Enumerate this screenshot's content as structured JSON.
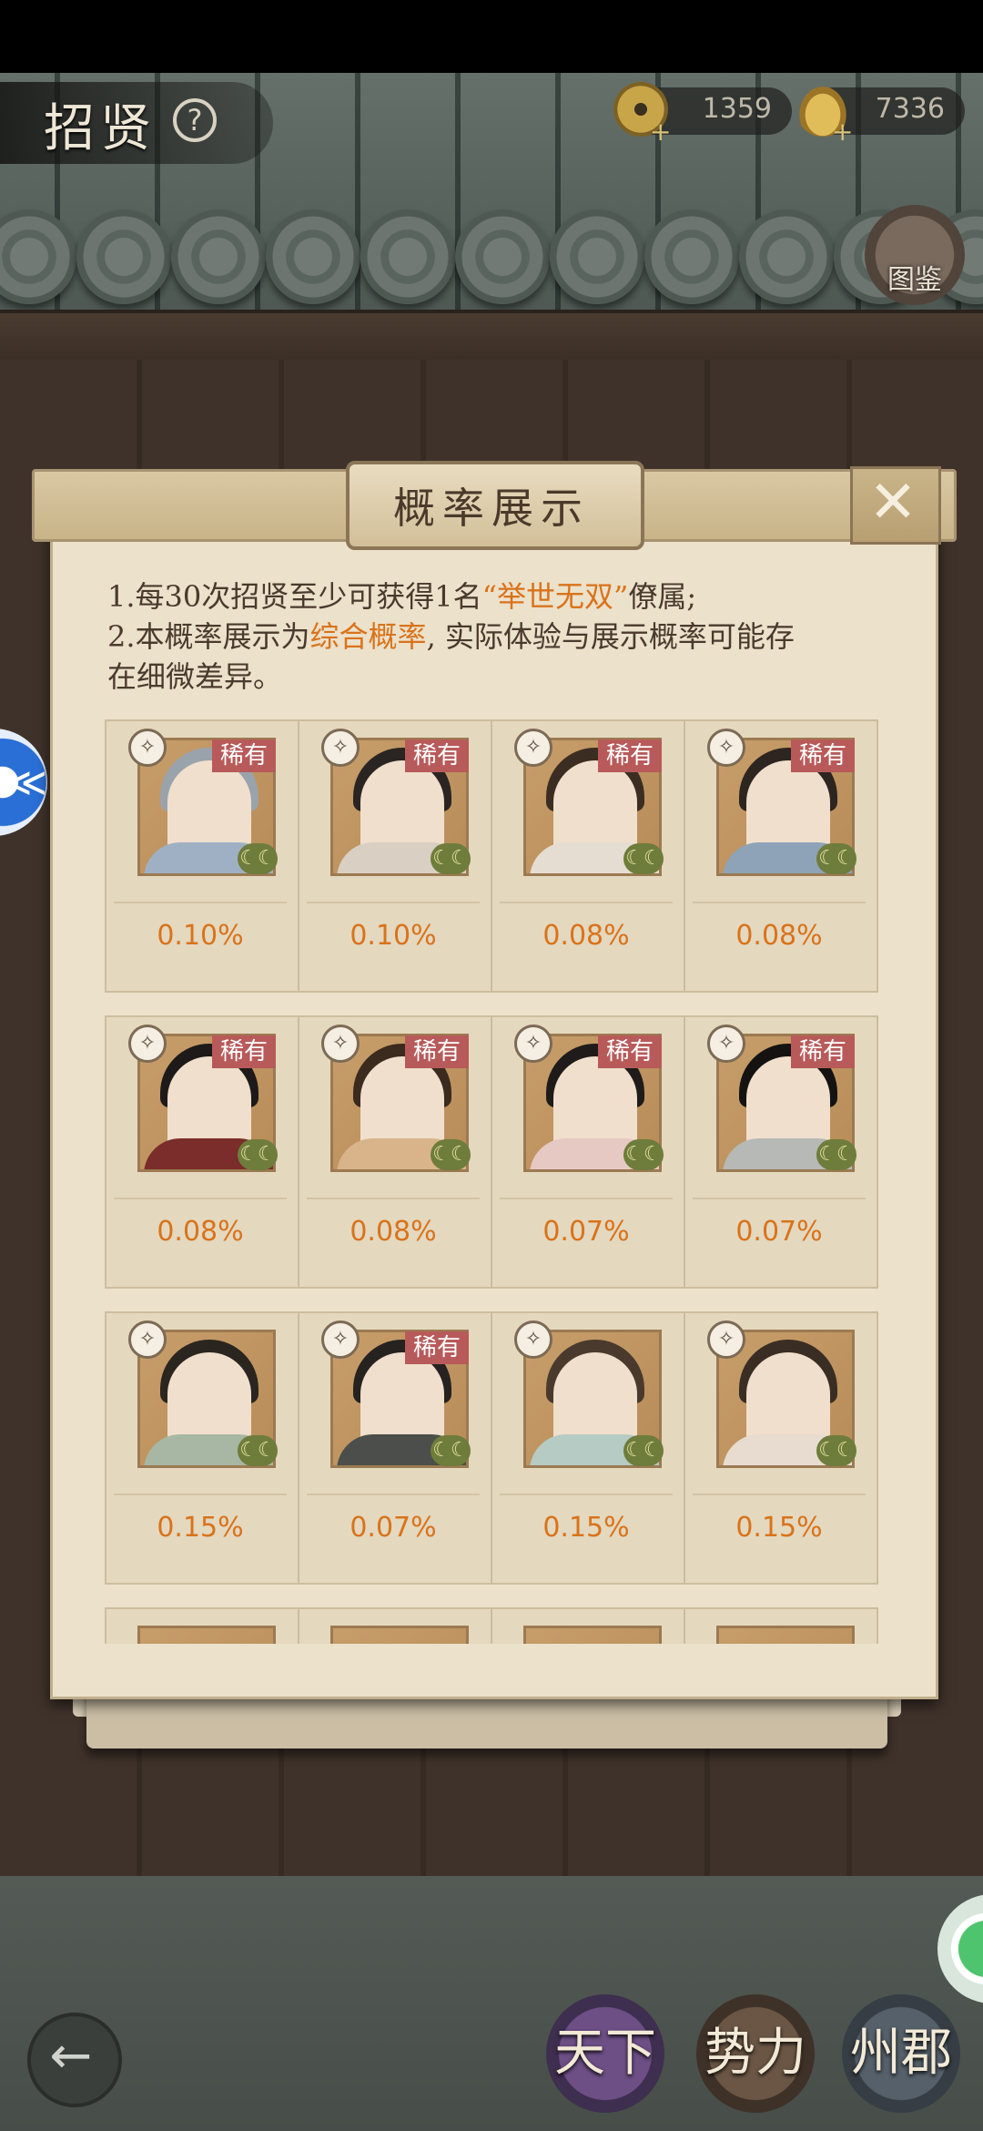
{
  "header": {
    "title": "招贤",
    "coins": "1359",
    "ingots": "7336",
    "codex_label": "图鉴"
  },
  "modal": {
    "title": "概率展示",
    "rules": [
      {
        "pre": "1.每30次招贤至少可获得1名",
        "highlight": "“举世无双”",
        "post": "僚属;"
      },
      {
        "pre": "2.本概率展示为",
        "highlight": "综合概率",
        "post": ", 实际体验与展示概率可能存"
      },
      {
        "pre": "在细微差异。",
        "highlight": "",
        "post": ""
      }
    ],
    "rare_label": "稀有",
    "characters": [
      {
        "prob": "0.10%",
        "rare": true,
        "robe": "#9fb0c4",
        "hair": "#9aa3ab"
      },
      {
        "prob": "0.10%",
        "rare": true,
        "robe": "#d9cfc2",
        "hair": "#2a2522"
      },
      {
        "prob": "0.08%",
        "rare": true,
        "robe": "#e5ddd2",
        "hair": "#3b2d22"
      },
      {
        "prob": "0.08%",
        "rare": true,
        "robe": "#8ea3b8",
        "hair": "#2d2520"
      },
      {
        "prob": "0.08%",
        "rare": true,
        "robe": "#7a2d2a",
        "hair": "#1d1a19"
      },
      {
        "prob": "0.08%",
        "rare": true,
        "robe": "#d9b48a",
        "hair": "#3b2a1e"
      },
      {
        "prob": "0.07%",
        "rare": true,
        "robe": "#e7c9c3",
        "hair": "#1e1b1a"
      },
      {
        "prob": "0.07%",
        "rare": true,
        "robe": "#b6b9b5",
        "hair": "#141312"
      },
      {
        "prob": "0.15%",
        "rare": false,
        "robe": "#a7b7a4",
        "hair": "#2b2520"
      },
      {
        "prob": "0.07%",
        "rare": true,
        "robe": "#4b4e4a",
        "hair": "#252220"
      },
      {
        "prob": "0.15%",
        "rare": false,
        "robe": "#b6cbc4",
        "hair": "#4a3a2d"
      },
      {
        "prob": "0.15%",
        "rare": false,
        "robe": "#e8dcd0",
        "hair": "#3a2d24"
      }
    ]
  },
  "nav": {
    "tianxia": "天下",
    "shili": "势力",
    "zhoujun": "州郡"
  }
}
